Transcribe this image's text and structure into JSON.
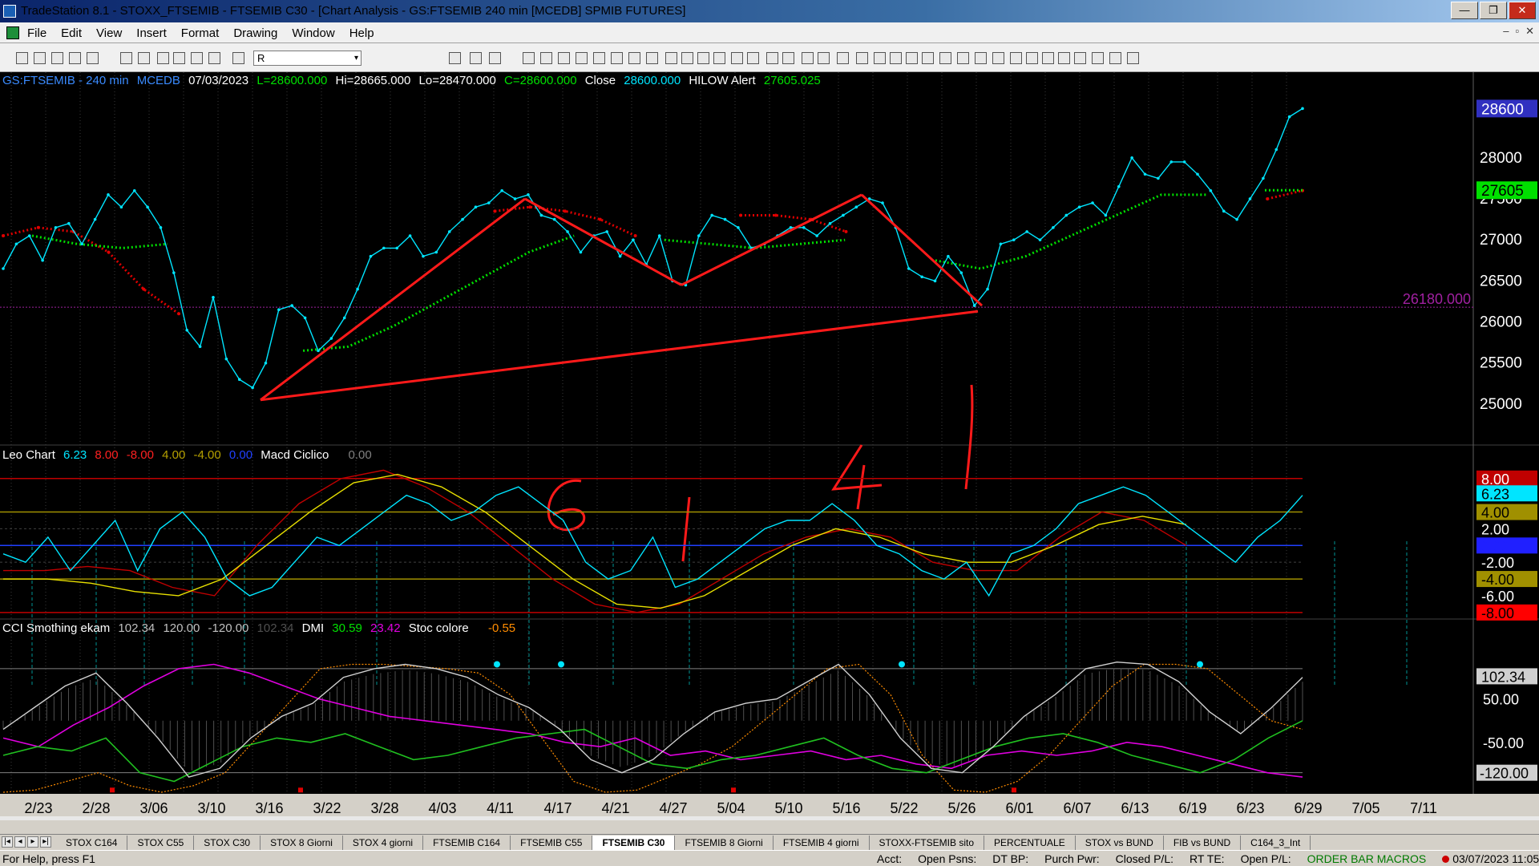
{
  "window": {
    "title": "TradeStation 8.1 - STOXX_FTSEMIB - FTSEMIB C30 - [Chart Analysis - GS:FTSEMIB  240 min  [MCEDB] SPMIB FUTURES]",
    "minimize": "—",
    "restore": "❐",
    "close": "✕"
  },
  "menu": {
    "items": [
      "File",
      "Edit",
      "View",
      "Insert",
      "Format",
      "Drawing",
      "Window",
      "Help"
    ],
    "mdi": [
      "–",
      "▫",
      "✕"
    ]
  },
  "toolbar": {
    "symbol_value": "R",
    "dropdown": "▾"
  },
  "price_info": {
    "symbol": "GS:FTSEMIB - 240 min",
    "source": "MCEDB",
    "date": "07/03/2023",
    "low_label": "L=28600.000",
    "high_label": "Hi=28665.000",
    "lo_label": "Lo=28470.000",
    "close_label": "C=28600.000",
    "close_name": "Close",
    "close_value": "28600.000",
    "hilow_name": "HILOW Alert",
    "hilow_value": "27605.025"
  },
  "leo_info": {
    "name": "Leo Chart",
    "v1": "6.23",
    "v2": "8.00",
    "v3": "-8.00",
    "v4": "4.00",
    "v5": "-4.00",
    "v6": "0.00",
    "macd_name": "Macd Ciclico",
    "macd_value": "0.00"
  },
  "cci_info": {
    "name": "CCI Smothing ekam",
    "v1": "102.34",
    "v2": "120.00",
    "v3": "-120.00",
    "v4": "102.34",
    "dmi_name": "DMI",
    "dmi1": "30.59",
    "dmi2": "23.42",
    "stoc_name": "Stoc colore",
    "stoc_value": "-0.55"
  },
  "colors": {
    "price": "#00e5ff",
    "red_dots": "#e00000",
    "green_dots": "#00e000",
    "drawing": "#ff1a1a",
    "yellow": "#e8e000",
    "magenta": "#e000e0",
    "green_line": "#20c020",
    "white_line": "#d0d0d0"
  },
  "chart_data": [
    {
      "type": "line",
      "panel": "price",
      "x_labels": [
        "2/23",
        "2/28",
        "3/06",
        "3/10",
        "3/16",
        "3/22",
        "3/28",
        "4/03",
        "4/11",
        "4/17",
        "4/21",
        "4/27",
        "5/04",
        "5/10",
        "5/16",
        "5/22",
        "5/26",
        "6/01",
        "6/07",
        "6/13",
        "6/19",
        "6/23",
        "6/29",
        "7/05",
        "7/11"
      ],
      "y_ticks": [
        25000,
        25500,
        26000,
        26500,
        27000,
        27500,
        28000
      ],
      "ylim": [
        24550,
        28750
      ],
      "series": [
        {
          "role": "price",
          "values": [
            26650,
            26950,
            27050,
            26750,
            27150,
            27200,
            26950,
            27250,
            27550,
            27400,
            27600,
            27400,
            27150,
            26600,
            25900,
            25700,
            26300,
            25550,
            25300,
            25200,
            25500,
            26150,
            26200,
            26050,
            25650,
            25800,
            26050,
            26400,
            26800,
            26900,
            26900,
            27050,
            26800,
            26850,
            27100,
            27250,
            27400,
            27450,
            27600,
            27500,
            27550,
            27300,
            27250,
            27100,
            26850,
            27050,
            27100,
            26800,
            27000,
            26700,
            27050,
            26500,
            26450,
            27050,
            27300,
            27250,
            27150,
            26900,
            26950,
            27050,
            27150,
            27150,
            27050,
            27200,
            27300,
            27400,
            27500,
            27450,
            27150,
            26650,
            26550,
            26500,
            26800,
            26600,
            26200,
            26400,
            26950,
            27000,
            27100,
            27000,
            27150,
            27300,
            27400,
            27450,
            27300,
            27650,
            28000,
            27800,
            27750,
            27950,
            27950,
            27800,
            27600,
            27350,
            27250,
            27500,
            27750,
            28100,
            28500,
            28600
          ]
        },
        {
          "role": "hilow_upper",
          "values": [
            27050,
            27150,
            27100,
            26850,
            26400,
            26100,
            null,
            null,
            null,
            null,
            null,
            null,
            null,
            null,
            27350,
            27400,
            27350,
            27250,
            27050,
            null,
            null,
            27300,
            27300,
            27250,
            27100,
            null,
            null,
            null,
            null,
            null,
            null,
            null,
            null,
            null,
            null,
            null,
            27500,
            27600
          ]
        },
        {
          "role": "hilow_lower",
          "values": [
            27050,
            26950,
            26900,
            26950,
            null,
            null,
            25650,
            25700,
            25950,
            26250,
            26550,
            26850,
            27050,
            null,
            27000,
            26950,
            26900,
            26950,
            27000,
            null,
            26750,
            26650,
            26800,
            27050,
            27300,
            27550,
            27550
          ]
        },
        {
          "role": "last_level",
          "values": [
            27605
          ]
        }
      ],
      "annotations": {
        "price_label": "28600",
        "hilow_label": "27605",
        "level_label": "26180.000",
        "level": 26180,
        "handwritten": [
          "6",
          "1",
          "4",
          "1"
        ]
      }
    },
    {
      "type": "line",
      "panel": "leo_chart",
      "y_ticks": [
        8,
        6.23,
        4,
        2,
        0,
        -2,
        -4,
        -6,
        -8
      ],
      "ylim": [
        -8.4,
        9.8
      ],
      "series": [
        {
          "role": "oscillator",
          "values": [
            -1,
            -2,
            1,
            -3,
            0,
            3,
            -3,
            2,
            4,
            1,
            -4,
            -6,
            -5,
            -2,
            1,
            0,
            2,
            4,
            6,
            5,
            3,
            4,
            6,
            7,
            5,
            3,
            -2,
            -4,
            -3,
            1,
            -5,
            -4,
            -2,
            0,
            2,
            3,
            3,
            5,
            3,
            0,
            -1,
            -3,
            -4,
            -2,
            -6,
            -1,
            0,
            2,
            5,
            6,
            7,
            6,
            4,
            2,
            0,
            -2,
            1,
            3,
            6
          ]
        },
        {
          "role": "macd_red",
          "values": [
            -3,
            -3,
            -2.5,
            -3,
            -5,
            -6,
            0,
            5,
            8,
            9,
            7,
            4,
            0,
            -4,
            -7,
            -8,
            -7,
            -4,
            -1,
            1,
            2,
            1,
            -2,
            -3,
            -3,
            1,
            4,
            3,
            0
          ]
        },
        {
          "role": "macd_yellow",
          "values": [
            -4,
            -4,
            -4.5,
            -5.5,
            -6,
            -4,
            0,
            4,
            7.5,
            8.5,
            7,
            4,
            0,
            -4,
            -7,
            -7.5,
            -6,
            -3,
            0,
            2,
            1,
            -1,
            -2,
            -2,
            0,
            2.5,
            3.5,
            2.5
          ]
        }
      ]
    },
    {
      "type": "line",
      "panel": "cci",
      "y_ticks": [
        102.34,
        50,
        -50,
        -120
      ],
      "ylim": [
        -165,
        190
      ],
      "series": [
        {
          "role": "cci_white",
          "values": [
            -20,
            30,
            80,
            110,
            40,
            -40,
            -130,
            -110,
            -40,
            10,
            40,
            100,
            120,
            130,
            120,
            100,
            60,
            30,
            -20,
            -90,
            -120,
            -90,
            -30,
            20,
            40,
            50,
            90,
            130,
            60,
            -40,
            -110,
            -120,
            -60,
            10,
            60,
            120,
            135,
            130,
            90,
            20,
            -30,
            30,
            100
          ]
        },
        {
          "role": "dmi_magenta",
          "values": [
            -40,
            -60,
            -10,
            30,
            80,
            120,
            130,
            110,
            80,
            50,
            30,
            10,
            0,
            -10,
            -20,
            -30,
            -50,
            -60,
            -40,
            -80,
            -70,
            -90,
            -80,
            -70,
            -90,
            -80,
            -100,
            -110,
            -80,
            -70,
            -80,
            -70,
            -50,
            -60,
            -80,
            -100,
            -120,
            -130
          ]
        },
        {
          "role": "dmi_green",
          "values": [
            -80,
            -60,
            -70,
            -40,
            -120,
            -140,
            -100,
            -60,
            -40,
            -50,
            -30,
            -60,
            -90,
            -80,
            -60,
            -40,
            -30,
            -20,
            -60,
            -100,
            -110,
            -90,
            -80,
            -60,
            -40,
            -80,
            -110,
            -120,
            -90,
            -60,
            -40,
            -30,
            -50,
            -80,
            -100,
            -120,
            -90,
            -40,
            0
          ]
        },
        {
          "role": "stoc_orange",
          "values": [
            -165,
            -160,
            -140,
            -120,
            -150,
            -165,
            -150,
            -120,
            -40,
            40,
            120,
            130,
            130,
            125,
            120,
            110,
            60,
            -40,
            -140,
            -165,
            -160,
            -130,
            -100,
            -60,
            0,
            60,
            120,
            130,
            60,
            -80,
            -160,
            -165,
            -140,
            -80,
            0,
            80,
            130,
            130,
            120,
            60,
            0,
            -20
          ]
        }
      ]
    }
  ],
  "tabs": {
    "nav": [
      "|◂",
      "◂",
      "▸",
      "▸|"
    ],
    "items": [
      "STOX C164",
      "STOX C55",
      "STOX  C30",
      "STOX  8 Giorni",
      "STOX 4 giorni",
      "FTSEMIB C164",
      "FTSEMIB C55",
      "FTSEMIB C30",
      "FTSEMIB  8 Giorni",
      "FTSEMIB  4 giorni",
      "STOXX-FTSEMIB sito",
      "PERCENTUALE",
      "STOX vs BUND",
      "FIB vs BUND",
      "C164_3_Int"
    ],
    "active_index": 7
  },
  "status": {
    "help": "For Help, press F1",
    "acct": "Acct:",
    "open_psns": "Open Psns:",
    "dt_bp": "DT BP:",
    "purch_pwr": "Purch Pwr:",
    "closed_pl": "Closed P/L:",
    "rt_te": "RT TE:",
    "open_pl": "Open P/L:",
    "order_bar": "ORDER BAR  MACROS",
    "datetime": "03/07/2023 11:05"
  }
}
